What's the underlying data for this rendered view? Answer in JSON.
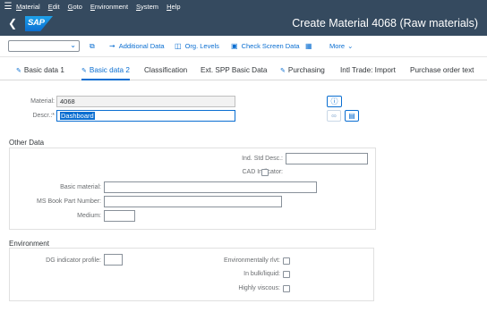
{
  "menu": {
    "items": [
      {
        "u": "M",
        "rest": "aterial"
      },
      {
        "u": "E",
        "rest": "dit"
      },
      {
        "u": "G",
        "rest": "oto"
      },
      {
        "u": "E",
        "rest": "nvironment"
      },
      {
        "u": "S",
        "rest": "ystem"
      },
      {
        "u": "H",
        "rest": "elp"
      }
    ]
  },
  "header": {
    "logo": "SAP",
    "title": "Create Material 4068 (Raw materials)"
  },
  "toolbar": {
    "select_value": "",
    "additional_data": "Additional Data",
    "org_levels": "Org. Levels",
    "check_screen_data": "Check Screen Data",
    "more": "More"
  },
  "tabs": [
    {
      "label": "Basic data 1"
    },
    {
      "label": "Basic data 2"
    },
    {
      "label": "Classification"
    },
    {
      "label": "Ext. SPP Basic Data"
    },
    {
      "label": "Purchasing"
    },
    {
      "label": "Intl Trade: Import"
    },
    {
      "label": "Purchase order text"
    }
  ],
  "material": {
    "material_label": "Material:",
    "material_value": "4068",
    "descr_label": "Descr.:*",
    "descr_value": "Dashboard"
  },
  "other_data": {
    "title": "Other Data",
    "ind_std_desc_label": "Ind. Std Desc.:",
    "ind_std_desc_value": "",
    "cad_indicator_label": "CAD Indicator:",
    "basic_material_label": "Basic material:",
    "basic_material_value": "",
    "ms_book_label": "MS Book Part Number:",
    "ms_book_value": "",
    "medium_label": "Medium:",
    "medium_value": ""
  },
  "environment": {
    "title": "Environment",
    "dg_profile_label": "DG indicator profile:",
    "dg_profile_value": "",
    "env_relevant_label": "Environmentally rlvt:",
    "in_bulk_label": "In bulk/liquid:",
    "highly_viscous_label": "Highly viscous:"
  },
  "colors": {
    "shell": "#354a5f",
    "accent": "#0a6ed1"
  }
}
